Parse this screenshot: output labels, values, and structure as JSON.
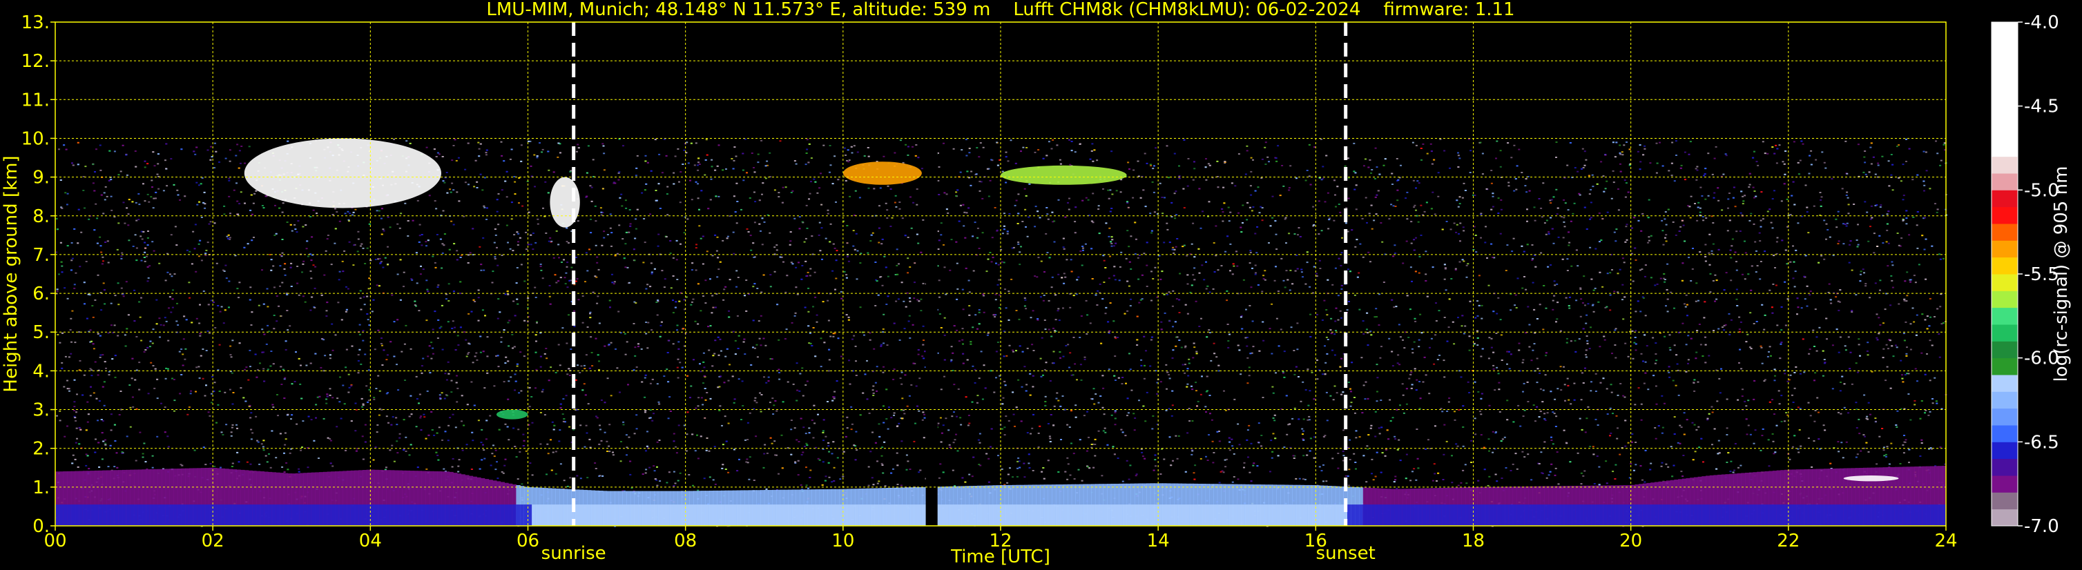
{
  "chart_data": {
    "type": "heatmap",
    "title": "LMU-MIM, Munich; 48.148° N 11.573° E, altitude: 539 m    Lufft CHM8k (CHM8kLMU): 06-02-2024    firmware: 1.11",
    "xlabel": "Time [UTC]",
    "ylabel": "Height above ground [km]",
    "xlim": [
      0,
      24
    ],
    "ylim": [
      0,
      13
    ],
    "x_ticks": [
      "00",
      "02",
      "04",
      "06",
      "08",
      "10",
      "12",
      "14",
      "16",
      "18",
      "20",
      "22",
      "24"
    ],
    "y_ticks": [
      "0.",
      "1.",
      "2.",
      "3.",
      "4.",
      "5.",
      "6.",
      "7.",
      "8.",
      "9.",
      "10.",
      "11.",
      "12.",
      "13."
    ],
    "grid": true,
    "grid_color": "#ffff00",
    "data_top_km": 10,
    "colorbar": {
      "label": "log(rc-signal) @ 905 nm",
      "range": [
        -7.0,
        -4.0
      ],
      "ticks": [
        "-4.0",
        "-4.5",
        "-5.0",
        "-5.5",
        "-6.0",
        "-6.5",
        "-7.0"
      ],
      "tick_values": [
        -4.0,
        -4.5,
        -5.0,
        -5.5,
        -6.0,
        -6.5,
        -7.0
      ],
      "palette": [
        {
          "from": -7.0,
          "to": -6.9,
          "color": "#b8a6b8"
        },
        {
          "from": -6.9,
          "to": -6.8,
          "color": "#8a6f8a"
        },
        {
          "from": -6.8,
          "to": -6.7,
          "color": "#7a0f8a"
        },
        {
          "from": -6.7,
          "to": -6.6,
          "color": "#4a0fa0"
        },
        {
          "from": -6.6,
          "to": -6.5,
          "color": "#2020d0"
        },
        {
          "from": -6.5,
          "to": -6.4,
          "color": "#3a6aff"
        },
        {
          "from": -6.4,
          "to": -6.3,
          "color": "#6a9aff"
        },
        {
          "from": -6.3,
          "to": -6.2,
          "color": "#8cb8ff"
        },
        {
          "from": -6.2,
          "to": -6.1,
          "color": "#b0d0ff"
        },
        {
          "from": -6.1,
          "to": -6.0,
          "color": "#2a9a2a"
        },
        {
          "from": -6.0,
          "to": -5.9,
          "color": "#1f8c3a"
        },
        {
          "from": -5.9,
          "to": -5.8,
          "color": "#20c060"
        },
        {
          "from": -5.8,
          "to": -5.7,
          "color": "#40e080"
        },
        {
          "from": -5.7,
          "to": -5.6,
          "color": "#a8f040"
        },
        {
          "from": -5.6,
          "to": -5.5,
          "color": "#e8f020"
        },
        {
          "from": -5.5,
          "to": -5.4,
          "color": "#ffd000"
        },
        {
          "from": -5.4,
          "to": -5.3,
          "color": "#ffa000"
        },
        {
          "from": -5.3,
          "to": -5.2,
          "color": "#ff6000"
        },
        {
          "from": -5.2,
          "to": -5.1,
          "color": "#ff1010"
        },
        {
          "from": -5.1,
          "to": -5.0,
          "color": "#e81020"
        },
        {
          "from": -5.0,
          "to": -4.9,
          "color": "#e8a0a8"
        },
        {
          "from": -4.9,
          "to": -4.8,
          "color": "#f0d8d8"
        },
        {
          "from": -4.8,
          "to": -4.0,
          "color": "#ffffff"
        }
      ]
    },
    "events": [
      {
        "label": "sunrise",
        "time_h": 6.58
      },
      {
        "label": "sunset",
        "time_h": 16.38
      }
    ],
    "data_gaps": [
      {
        "from_h": 11.05,
        "to_h": 11.2
      }
    ],
    "features": [
      {
        "kind": "cloud",
        "t0": 2.4,
        "t1": 4.9,
        "z0": 8.2,
        "z1": 10.0,
        "value": -4.6
      },
      {
        "kind": "cloud",
        "t0": 6.28,
        "t1": 6.66,
        "z0": 7.7,
        "z1": 9.0,
        "value": -4.7
      },
      {
        "kind": "cloud",
        "t0": 10.0,
        "t1": 11.0,
        "z0": 8.8,
        "z1": 9.4,
        "value": -5.3
      },
      {
        "kind": "cloud",
        "t0": 12.0,
        "t1": 13.6,
        "z0": 8.8,
        "z1": 9.3,
        "value": -5.6
      },
      {
        "kind": "aerosol",
        "t0": 5.6,
        "t1": 6.0,
        "z0": 2.75,
        "z1": 3.0,
        "value": -5.85
      },
      {
        "kind": "cloud",
        "t0": 22.7,
        "t1": 23.4,
        "z0": 1.15,
        "z1": 1.3,
        "value": -4.5
      }
    ],
    "boundary_layer": [
      {
        "t": 0,
        "top": 1.4
      },
      {
        "t": 1,
        "top": 1.45
      },
      {
        "t": 2,
        "top": 1.5
      },
      {
        "t": 3,
        "top": 1.35
      },
      {
        "t": 4,
        "top": 1.45
      },
      {
        "t": 5,
        "top": 1.4
      },
      {
        "t": 6,
        "top": 1.0
      },
      {
        "t": 7,
        "top": 0.9
      },
      {
        "t": 8,
        "top": 0.9
      },
      {
        "t": 10,
        "top": 0.95
      },
      {
        "t": 12,
        "top": 1.05
      },
      {
        "t": 14,
        "top": 1.1
      },
      {
        "t": 16,
        "top": 1.05
      },
      {
        "t": 17,
        "top": 0.95
      },
      {
        "t": 18,
        "top": 1.0
      },
      {
        "t": 20,
        "top": 1.05
      },
      {
        "t": 21,
        "top": 1.3
      },
      {
        "t": 22,
        "top": 1.45
      },
      {
        "t": 23,
        "top": 1.5
      },
      {
        "t": 24,
        "top": 1.55
      }
    ]
  }
}
